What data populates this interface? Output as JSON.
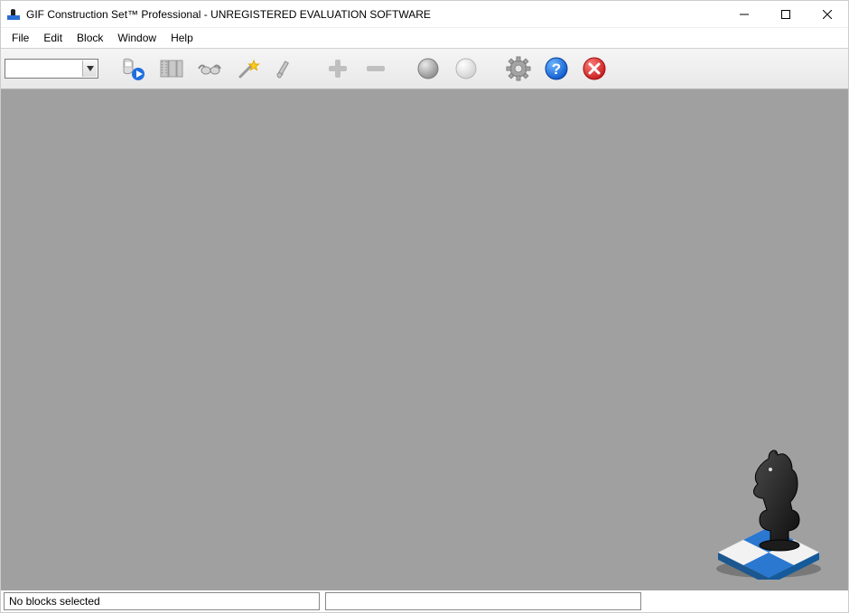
{
  "window": {
    "title": "GIF Construction Set™ Professional - UNREGISTERED EVALUATION SOFTWARE"
  },
  "menu": {
    "file": "File",
    "edit": "Edit",
    "block": "Block",
    "window": "Window",
    "help": "Help"
  },
  "toolbar": {
    "combo_value": "",
    "icons": {
      "open_play": "open-play-icon",
      "filmstrip": "filmstrip-icon",
      "glasses": "glasses-icon",
      "wand": "magic-wand-icon",
      "brush": "brush-icon",
      "plus": "plus-icon",
      "minus": "minus-icon",
      "sphere_dark": "sphere-dark-icon",
      "sphere_light": "sphere-light-icon",
      "gear": "gear-icon",
      "help": "help-icon",
      "close": "close-x-icon"
    }
  },
  "status": {
    "pane1": "No blocks selected",
    "pane2": ""
  },
  "logo": {
    "name": "knight-chess-logo"
  }
}
